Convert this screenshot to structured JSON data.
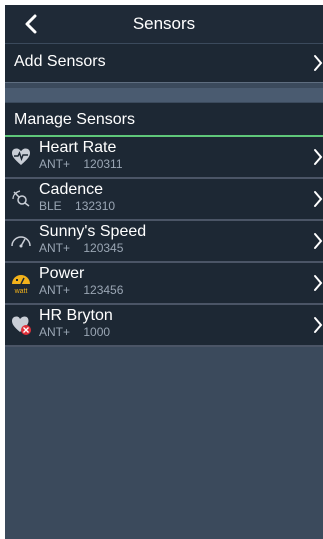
{
  "header": {
    "title": "Sensors"
  },
  "add_row": {
    "label": "Add Sensors"
  },
  "section": {
    "label": "Manage Sensors"
  },
  "sensors": [
    {
      "name": "Heart Rate",
      "protocol": "ANT+",
      "id": "120311",
      "icon": "heart-icon"
    },
    {
      "name": "Cadence",
      "protocol": "BLE",
      "id": "132310",
      "icon": "cadence-icon"
    },
    {
      "name": "Sunny's Speed",
      "protocol": "ANT+",
      "id": "120345",
      "icon": "speed-icon"
    },
    {
      "name": "Power",
      "protocol": "ANT+",
      "id": "123456",
      "icon": "power-icon",
      "icon_label": "watt"
    },
    {
      "name": "HR Bryton",
      "protocol": "ANT+",
      "id": "1000",
      "icon": "heart-disconnected-icon"
    }
  ],
  "colors": {
    "accent_green": "#5fc77a",
    "power_yellow": "#f2b21b",
    "error_red": "#e0303a"
  }
}
